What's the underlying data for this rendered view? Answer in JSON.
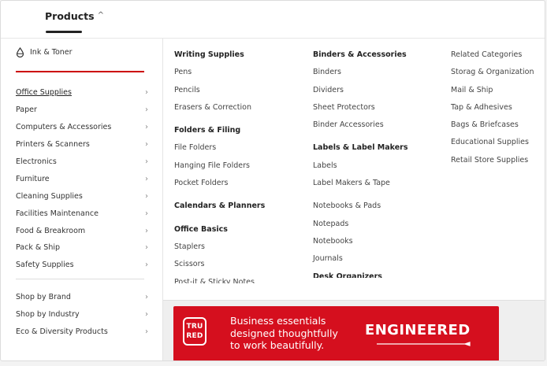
{
  "header": {
    "products_label": "Products",
    "caret": "^"
  },
  "sidebar": {
    "ink_toner": "Ink & Toner",
    "categories": [
      {
        "label": "Office Supplies",
        "active": true
      },
      {
        "label": "Paper"
      },
      {
        "label": "Computers & Accessories"
      },
      {
        "label": "Printers & Scanners"
      },
      {
        "label": "Electronics"
      },
      {
        "label": "Furniture"
      },
      {
        "label": "Cleaning Supplies"
      },
      {
        "label": "Facilities Maintenance"
      },
      {
        "label": "Food & Breakroom"
      },
      {
        "label": "Pack & Ship"
      },
      {
        "label": "Safety Supplies"
      }
    ],
    "bottom": [
      {
        "label": "Shop by Brand"
      },
      {
        "label": "Shop by Industry"
      },
      {
        "label": "Eco & Diversity Products"
      }
    ],
    "chevron": "›"
  },
  "columns": {
    "col1": {
      "writing_title": "Writing Supplies",
      "writing_items": [
        "Pens",
        "Pencils",
        "Erasers & Correction"
      ],
      "folders_title": "Folders & Filing",
      "folders_items": [
        "File Folders",
        "Hanging File Folders",
        "Pocket Folders"
      ],
      "calendars_title": "Calendars & Planners",
      "basics_title": "Office Basics",
      "basics_items": [
        "Staplers",
        "Scissors",
        "Post-it & Sticky Notes"
      ]
    },
    "col2": {
      "binders_title": "Binders & Accessories",
      "binders_items": [
        "Binders",
        "Dividers",
        "Sheet Protectors",
        "Binder Accessories"
      ],
      "labels_title": "Labels & Label Makers",
      "labels_items": [
        "Labels",
        "Label Makers & Tape"
      ],
      "notebooks_items": [
        "Notebooks & Pads",
        "Notepads",
        "Notebooks",
        "Journals"
      ],
      "desk_title": "Desk Organizers"
    },
    "col3": {
      "related_title": "Related Categories",
      "related_items": [
        "Storag & Organization",
        "Mail & Ship",
        "Tap & Adhesives",
        "Bags & Briefcases",
        "Educational Supplies",
        "Retail Store Supplies"
      ]
    }
  },
  "banner": {
    "logo_line1": "TRU",
    "logo_line2": "RED",
    "text_line1": "Business essentials",
    "text_line2": "designed thoughtfully",
    "text_line3": "to work beautifully.",
    "engineered": "ENGINEERED",
    "color": "#d50f1e"
  },
  "colors": {
    "accent_red": "#cc0000"
  }
}
